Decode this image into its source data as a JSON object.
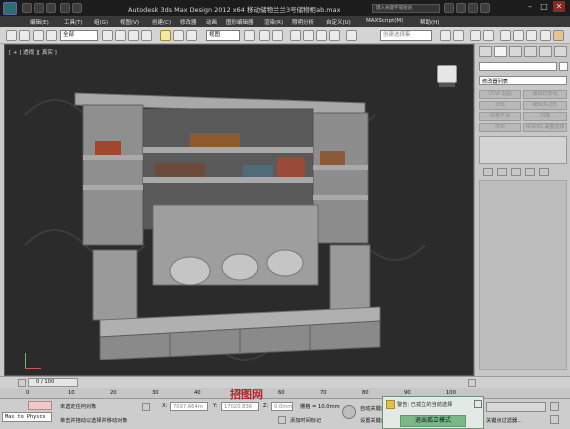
{
  "titlebar": {
    "title": "Autodesk 3ds Max Design 2012 x64      移动储物兰兰3号储物柜ab.max",
    "search_placeholder": "键入关键字或短语"
  },
  "menubar": {
    "items": [
      "编辑(E)",
      "工具(T)",
      "组(G)",
      "视图(V)",
      "创建(C)",
      "修改器",
      "动画",
      "图形编辑器",
      "渲染(R)",
      "照明分析",
      "自定义(U)",
      "MAXScript(M)",
      "帮助(H)"
    ]
  },
  "toolbar": {
    "selection_filter": "全部",
    "reference_coord": "视图",
    "named_selection_placeholder": "创建选择集"
  },
  "viewport": {
    "label": "[ + ] 透视 ][ 真实 ]"
  },
  "command_panel": {
    "modifier_list_label": "修改器列表",
    "buttons": [
      "UVW 贴图",
      "编辑样条线",
      "法线",
      "编辑多边形",
      "网格平滑",
      "扫描",
      "挤出",
      "NURBS 曲面选择"
    ]
  },
  "timeline": {
    "frame_counter": "0 / 100",
    "ruler_ticks": [
      "0",
      "10",
      "20",
      "30",
      "40",
      "50",
      "60",
      "70",
      "80",
      "90",
      "100"
    ]
  },
  "statusbar": {
    "script_listener": "Max to Physcs",
    "selection_status": "未选定任何对象",
    "prompt": "单击并拖动以选择并移动对象",
    "x_label": "X:",
    "x_value": "7097.664m",
    "y_label": "Y:",
    "y_value": "17020.836",
    "z_label": "Z:",
    "z_value": "0.0mm",
    "grid": "栅格 = 10.0mm",
    "add_time_tag": "添加时间标记",
    "auto_key": "自动关键点",
    "set_key": "设置关键点",
    "key_filters": "关键点过滤器..."
  },
  "warning_dialog": {
    "text": "警告: 已孤立的当前选择",
    "button": "退出孤立模式"
  },
  "watermark": {
    "logo_text": "我图网",
    "center_brand": "招图网"
  },
  "colors": {
    "titlebar_bg": "#1c1c1c",
    "viewport_bg": "#2b2b2b",
    "model_gray": "#9a9a9a",
    "exit_button_green": "#79b988"
  }
}
